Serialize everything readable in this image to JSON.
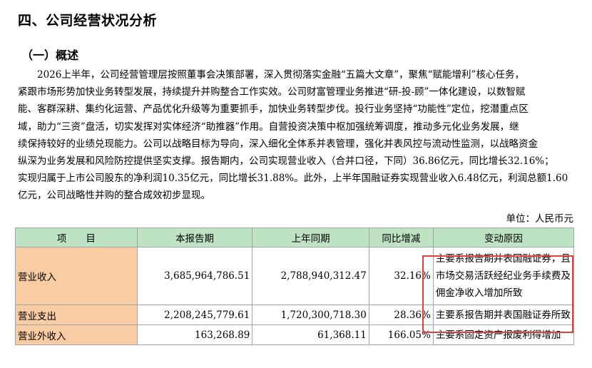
{
  "section_title": "四、公司经营状况分析",
  "subsection_title": "（一）概述",
  "paragraph_lines": [
    "　　2026上半年，公司经营管理层按照董事会决策部署，深入贯彻落实金融“五篇大文章”，聚焦“赋能增利”核心任务，",
    "紧跟市场形势加快业务转型发展，持续提升并购整合工作实效。公司财富管理业务推进“研-投-顾”一体化建设，以数智赋",
    "能、客群深耕、集约化运营、产品优化升级等为重要抓手，加快业务转型步伐。投行业务坚持“功能性”定位，挖潜重点区",
    "域，助力“三资”盘活，切实发挥对实体经济“助推器”作用。自营投资决策中枢加强统筹调度，推动多元化业务发展，继",
    "续保持较好的业绩兑现能力。公司以战略目标为导向，深入细化全体系并表管理，强化并表风控与流动性监测，以战略资金",
    "纵深为业务发展和风险防控提供坚实支撑。报告期内，公司实现营业收入（合并口径，下同）36.86亿元，同比增长32.16%；",
    "实现归属于上市公司股东的净利润10.35亿元，同比增长31.88%。此外，上半年国融证券实现营业收入6.48亿元，利润总额1.60",
    "亿元，公司战略性并购的整合成效初步显现。"
  ],
  "unit_label": "单位：人民币元",
  "table": {
    "headers": [
      "项　　目",
      "本报告期",
      "上年同期",
      "同比增减",
      "变动原因"
    ],
    "rows": [
      {
        "item": "营业收入",
        "current": "3,685,964,786.51",
        "previous": "2,788,940,312.47",
        "change": "32.16%",
        "reason_lines": [
          "主要系报告期并表国融证券，且",
          "市场交易活跃经纪业务手续费及",
          "佣金净收入增加所致"
        ]
      },
      {
        "item": "营业支出",
        "current": "2,208,245,779.61",
        "previous": "1,720,300,718.30",
        "change": "28.36%",
        "reason_lines": [
          "主要系报告期并表国融证券所致"
        ]
      },
      {
        "item": "营业外收入",
        "current": "163,268.89",
        "previous": "61,368.11",
        "change": "166.05%",
        "reason_lines": [
          "主要系固定资产报废利得增加"
        ]
      }
    ]
  },
  "colors": {
    "header_bg": "#bde3c2",
    "item_bg": "#f9cca4",
    "highlight_border": "#e0413f"
  }
}
